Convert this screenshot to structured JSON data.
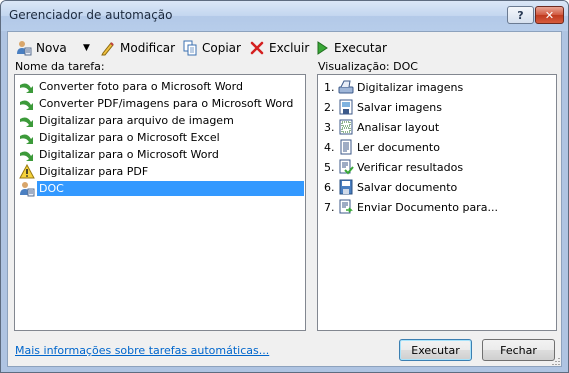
{
  "window": {
    "title": "Gerenciador de automação",
    "help_label": "?",
    "close_label": "✕"
  },
  "toolbar": {
    "nova": "Nova",
    "modificar": "Modificar",
    "copiar": "Copiar",
    "excluir": "Excluir",
    "executar": "Executar"
  },
  "tasks": {
    "label": "Nome da tarefa:",
    "items": [
      {
        "label": "Converter foto para o Microsoft Word",
        "icon": "green-arrow-icon"
      },
      {
        "label": "Converter PDF/imagens para o Microsoft Word",
        "icon": "green-arrow-icon"
      },
      {
        "label": "Digitalizar para arquivo de imagem",
        "icon": "green-arrow-icon"
      },
      {
        "label": "Digitalizar para o Microsoft Excel",
        "icon": "green-arrow-icon"
      },
      {
        "label": "Digitalizar para o Microsoft Word",
        "icon": "green-arrow-icon"
      },
      {
        "label": "Digitalizar para PDF",
        "icon": "warning-icon"
      },
      {
        "label": "DOC",
        "icon": "user-task-icon",
        "selected": true
      }
    ]
  },
  "preview": {
    "label": "Visualização: DOC",
    "steps": [
      {
        "num": "1.",
        "label": "Digitalizar imagens",
        "icon": "scanner-icon"
      },
      {
        "num": "2.",
        "label": "Salvar imagens",
        "icon": "save-images-icon"
      },
      {
        "num": "3.",
        "label": "Analisar layout",
        "icon": "analyze-layout-icon"
      },
      {
        "num": "4.",
        "label": "Ler documento",
        "icon": "read-document-icon"
      },
      {
        "num": "5.",
        "label": "Verificar resultados",
        "icon": "verify-icon"
      },
      {
        "num": "6.",
        "label": "Salvar documento",
        "icon": "save-icon"
      },
      {
        "num": "7.",
        "label": "Enviar Documento para...",
        "icon": "send-document-icon"
      }
    ]
  },
  "footer": {
    "link": "Mais informações sobre tarefas automáticas...",
    "execute_button": "Executar",
    "close_button": "Fechar"
  },
  "colors": {
    "selection": "#3399ff",
    "link": "#0066cc"
  }
}
